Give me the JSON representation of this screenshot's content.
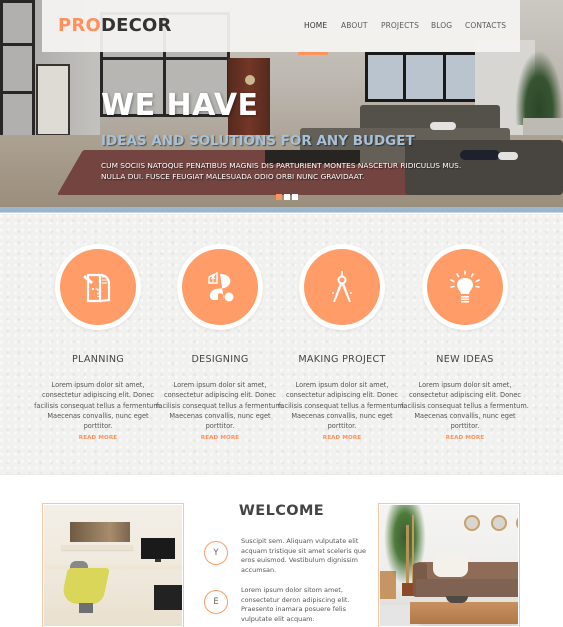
{
  "brand": {
    "logo_prefix": "PRO",
    "logo_suffix": "DECOR",
    "accent_color": "#ff915a"
  },
  "nav": {
    "items": [
      {
        "label": "HOME",
        "active": true
      },
      {
        "label": "ABOUT",
        "active": false
      },
      {
        "label": "PROJECTS",
        "active": false
      },
      {
        "label": "BLOG",
        "active": false
      },
      {
        "label": "CONTACTS",
        "active": false
      }
    ]
  },
  "hero": {
    "title": "WE HAVE",
    "subtitle": "IDEAS AND SOLUTIONS FOR ANY BUDGET",
    "body_line1": "CUM SOCIIS NATOQUE PENATIBUS MAGNIS DIS PARTURIENT MONTES NASCETUR RIDICULUS MUS.",
    "body_line2": "NULLA DUI. FUSCE FEUGIAT MALESUADA ODIO ORBI NUNC GRAVIDAAT.",
    "slides": {
      "count": 3,
      "active_index": 0
    }
  },
  "features": [
    {
      "icon": "blueprint-icon",
      "title": "PLANNING",
      "text": "Lorem ipsum dolor sit amet, consectetur adipiscing elit. Donec facilisis consequat tellus a fermentum. Maecenas convallis, nunc eget porttitor.",
      "link": "READ MORE"
    },
    {
      "icon": "design-palette-icon",
      "title": "DESIGNING",
      "text": "Lorem ipsum dolor sit amet, consectetur adipiscing elit. Donec facilisis consequat tellus a fermentum. Maecenas convallis, nunc eget porttitor.",
      "link": "READ MORE"
    },
    {
      "icon": "compass-icon",
      "title": "MAKING PROJECT",
      "text": "Lorem ipsum dolor sit amet, consectetur adipiscing elit. Donec facilisis consequat tellus a fermentum. Maecenas convallis, nunc eget porttitor.",
      "link": "READ MORE"
    },
    {
      "icon": "lightbulb-icon",
      "title": "NEW IDEAS",
      "text": "Lorem ipsum dolor sit amet, consectetur adipiscing elit. Donec facilisis consequat tellus a fermentum. Maecenas convallis, nunc eget porttitor.",
      "link": "READ MORE"
    }
  ],
  "welcome": {
    "title": "WELCOME",
    "items": [
      {
        "letter": "Y",
        "text": "Suscipit sem. Aliquam vulputate elit acquam tristique sit amet sceleris que eros euismod. Vestibulum dignissim accumsan."
      },
      {
        "letter": "E",
        "text": "Lorem ipsum dolor sitom amet, consectetur deron adipiscing elit. Praesento inamara posuere felis vulputate elit acquam."
      }
    ]
  }
}
